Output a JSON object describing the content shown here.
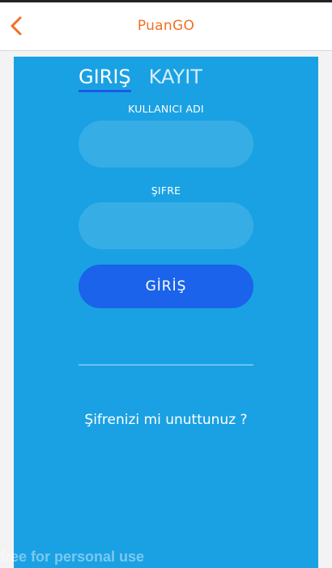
{
  "app_bar": {
    "title": "PuanGO",
    "back_icon": "chevron-left-icon",
    "accent_color": "#f36f21"
  },
  "tabs": [
    {
      "label": "GIRIŞ",
      "active": true
    },
    {
      "label": "KAYIT",
      "active": false
    }
  ],
  "form": {
    "username_label": "KULLANICI ADI",
    "username_value": "",
    "password_label": "ŞIFRE",
    "password_value": "",
    "submit_label": "GİRİŞ"
  },
  "forgot_password": "Şifrenizi mi unuttunuz ?",
  "watermark": "free for personal use",
  "colors": {
    "panel": "#1aa1e3",
    "button": "#1a63ea",
    "tab_underline": "#1f58e6"
  }
}
